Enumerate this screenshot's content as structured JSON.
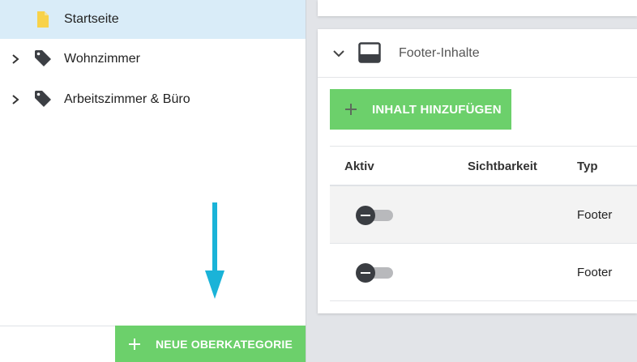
{
  "sidebar": {
    "items": [
      {
        "label": "Startseite",
        "icon": "page-icon",
        "selected": true,
        "expandable": false
      },
      {
        "label": "Wohnzimmer",
        "icon": "tag-icon",
        "selected": false,
        "expandable": true
      },
      {
        "label": "Arbeitszimmer & Büro",
        "icon": "tag-icon",
        "selected": false,
        "expandable": true
      }
    ],
    "new_category_label": "NEUE OBERKATEGORIE"
  },
  "panel": {
    "title": "Footer-Inhalte",
    "add_content_label": "INHALT HINZUFÜGEN",
    "columns": [
      "Aktiv",
      "Sichtbarkeit",
      "Typ"
    ],
    "rows": [
      {
        "active": false,
        "visibility": "",
        "type": "Footer"
      },
      {
        "active": false,
        "visibility": "",
        "type": "Footer"
      }
    ]
  },
  "colors": {
    "accent_green": "#6cd06b",
    "selected_bg": "#d9ecf8",
    "arrow": "#1ab3d8",
    "page_icon": "#f8d24a",
    "tag_icon": "#3c3f44"
  }
}
